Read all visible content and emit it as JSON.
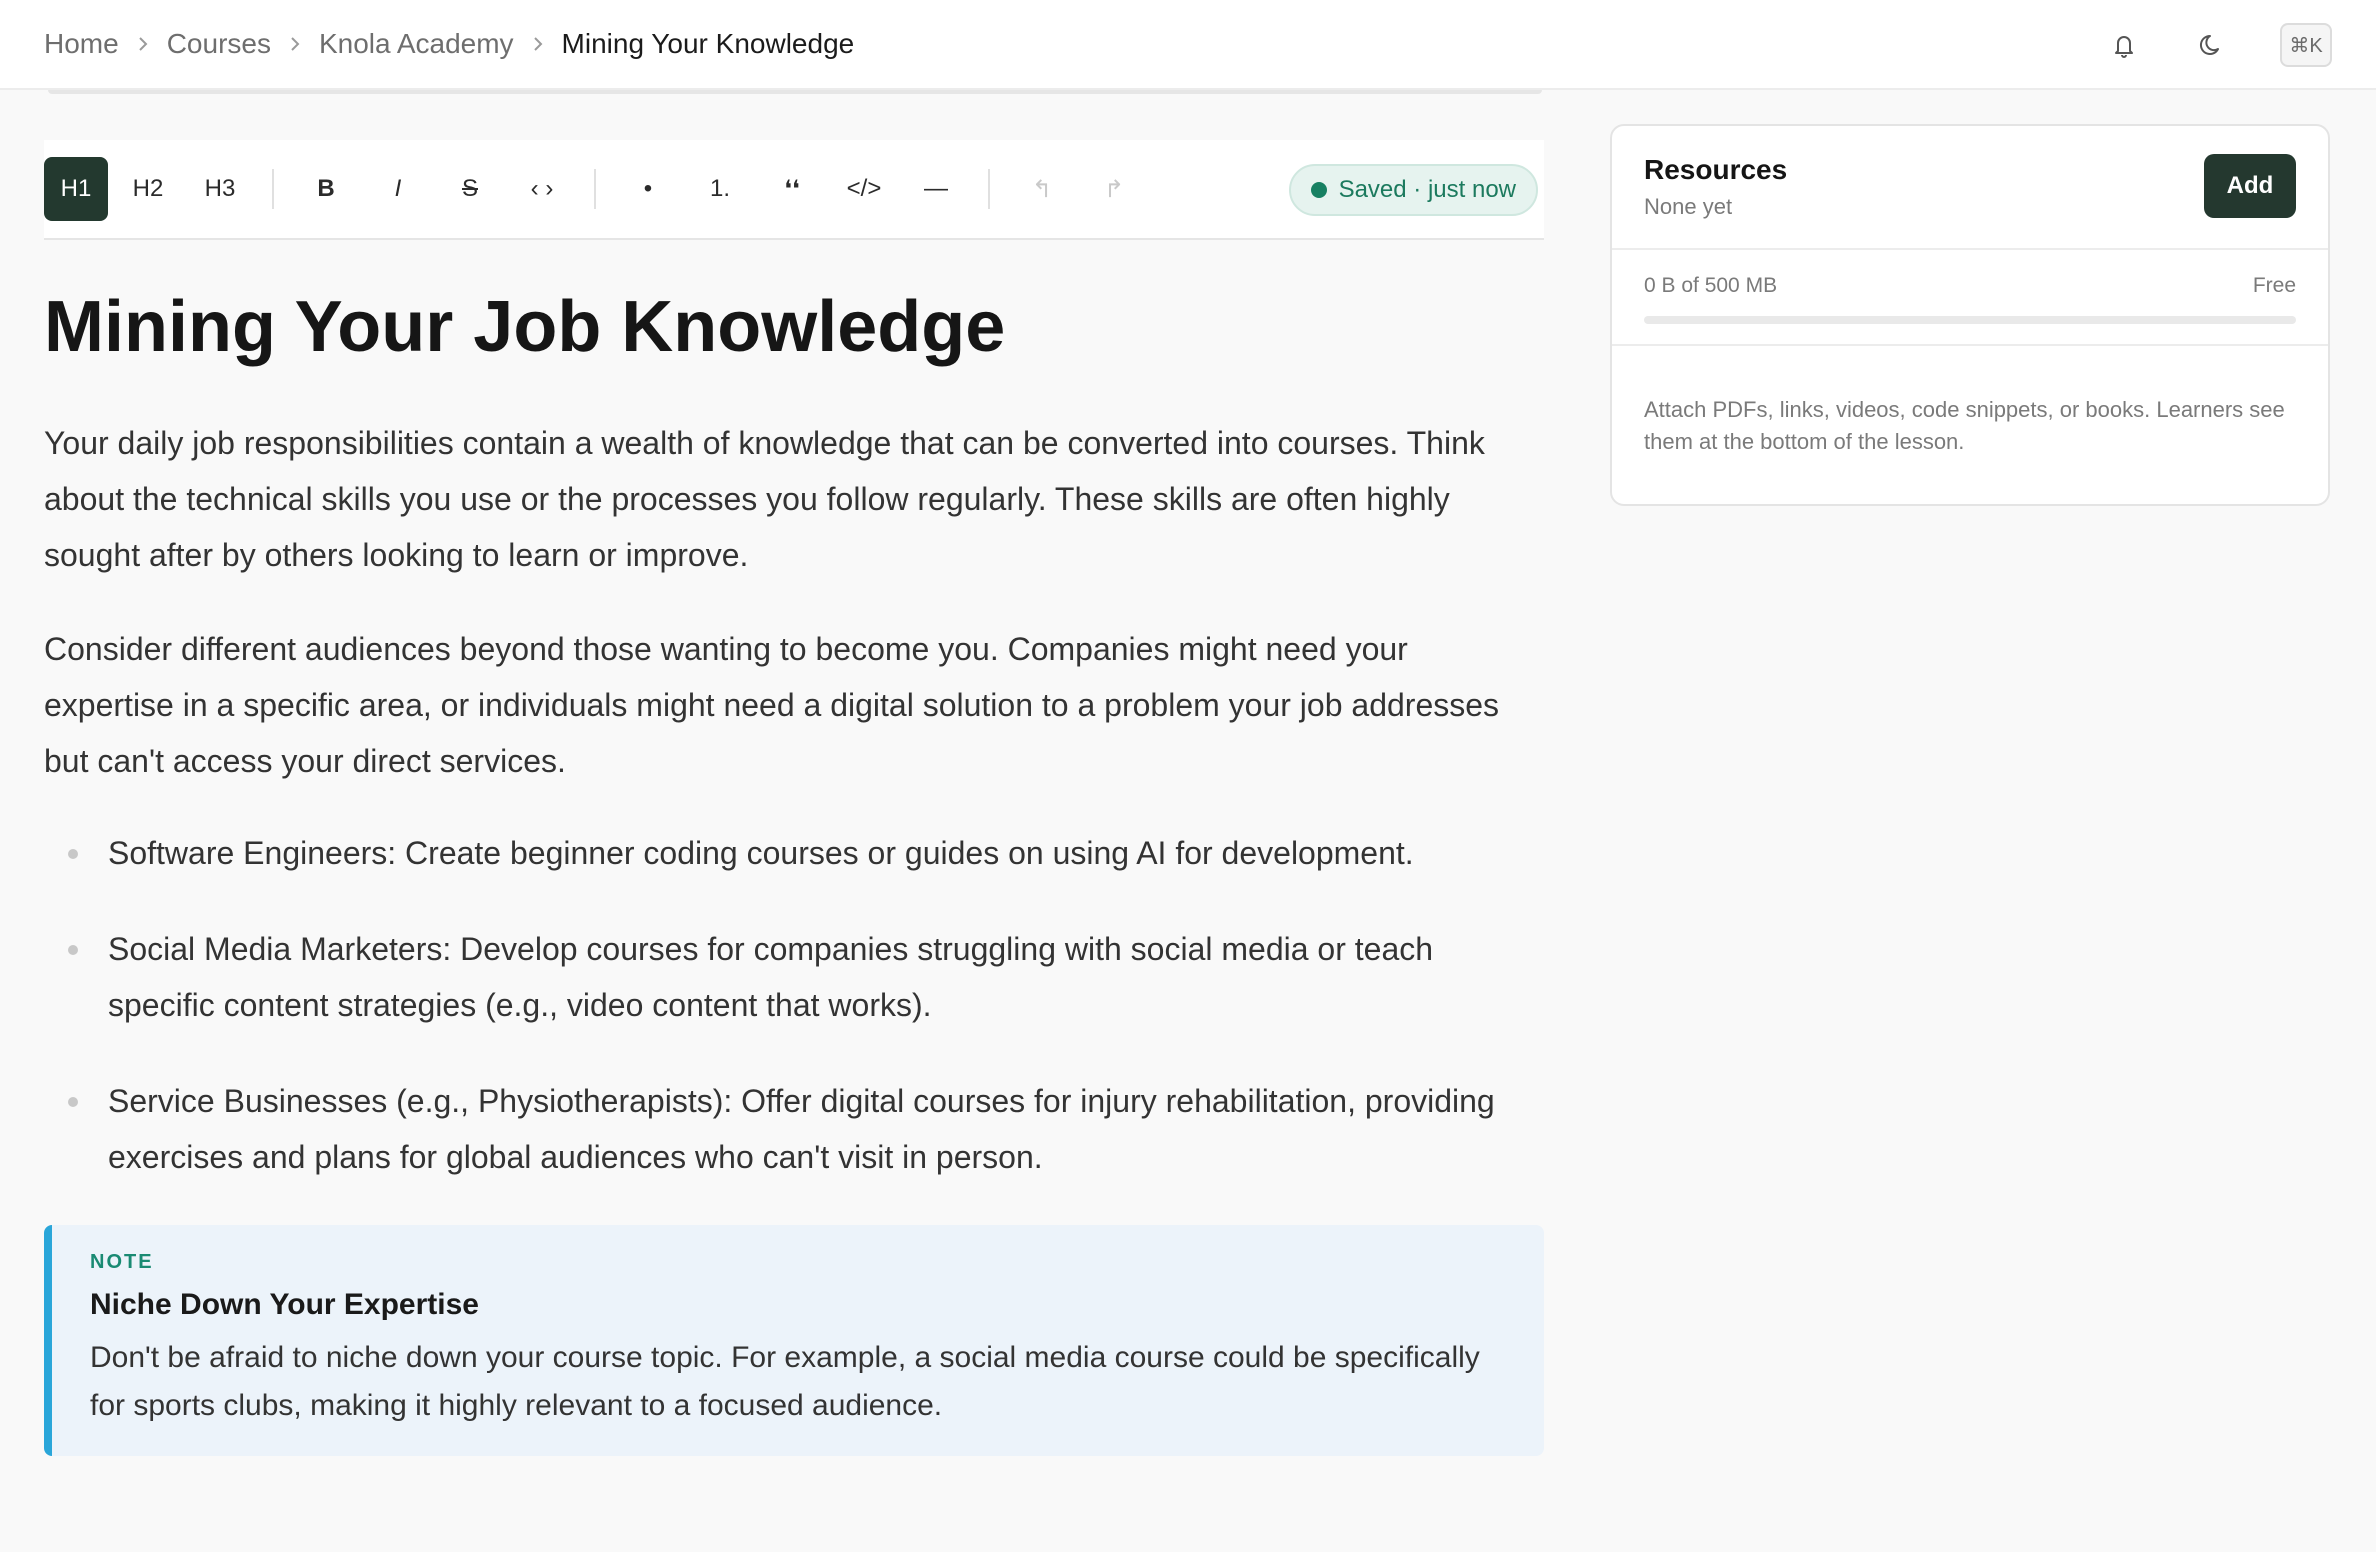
{
  "breadcrumb": {
    "items": [
      "Home",
      "Courses",
      "Knola Academy"
    ],
    "current": "Mining Your Knowledge"
  },
  "topbar": {
    "notifications_icon": "bell-icon",
    "theme_icon": "moon-icon",
    "command_shortcut": "⌘K"
  },
  "toolbar": {
    "h1": "H1",
    "h2": "H2",
    "h3": "H3",
    "bold": "B",
    "italic": "I",
    "strike": "S",
    "inline_code": "‹ ›",
    "bullet_list": "•",
    "ordered_list": "1.",
    "quote": "❛❛",
    "code_block": "</>",
    "divider": "—",
    "undo": "↰",
    "redo": "↱",
    "status": "Saved · just now"
  },
  "document": {
    "title": "Mining Your Job Knowledge",
    "paragraphs": [
      "Your daily job responsibilities contain a wealth of knowledge that can be converted into courses. Think about the technical skills you use or the processes you follow regularly. These skills are often highly sought after by others looking to learn or improve.",
      "Consider different audiences beyond those wanting to become you. Companies might need your expertise in a specific area, or individuals might need a digital solution to a problem your job addresses but can't access your direct services."
    ],
    "bullets": [
      "Software Engineers: Create beginner coding courses or guides on using AI for development.",
      "Social Media Marketers: Develop courses for companies struggling with social media or teach specific content strategies (e.g., video content that works).",
      "Service Businesses (e.g., Physiotherapists): Offer digital courses for injury rehabilitation, providing exercises and plans for global audiences who can't visit in person."
    ],
    "note": {
      "label": "NOTE",
      "title": "Niche Down Your Expertise",
      "body": "Don't be afraid to niche down your course topic. For example, a social media course could be specifically for sports clubs, making it highly relevant to a focused audience."
    }
  },
  "resources": {
    "title": "Resources",
    "subtitle": "None yet",
    "add_label": "Add",
    "storage_used": "0 B of 500 MB",
    "plan": "Free",
    "storage_fraction": 0,
    "help_text": "Attach PDFs, links, videos, code snippets, or books. Learners see them at the bottom of the lesson."
  },
  "colors": {
    "accent_dark": "#24382f",
    "saved_green": "#178062",
    "note_border": "#2aa6d9"
  }
}
